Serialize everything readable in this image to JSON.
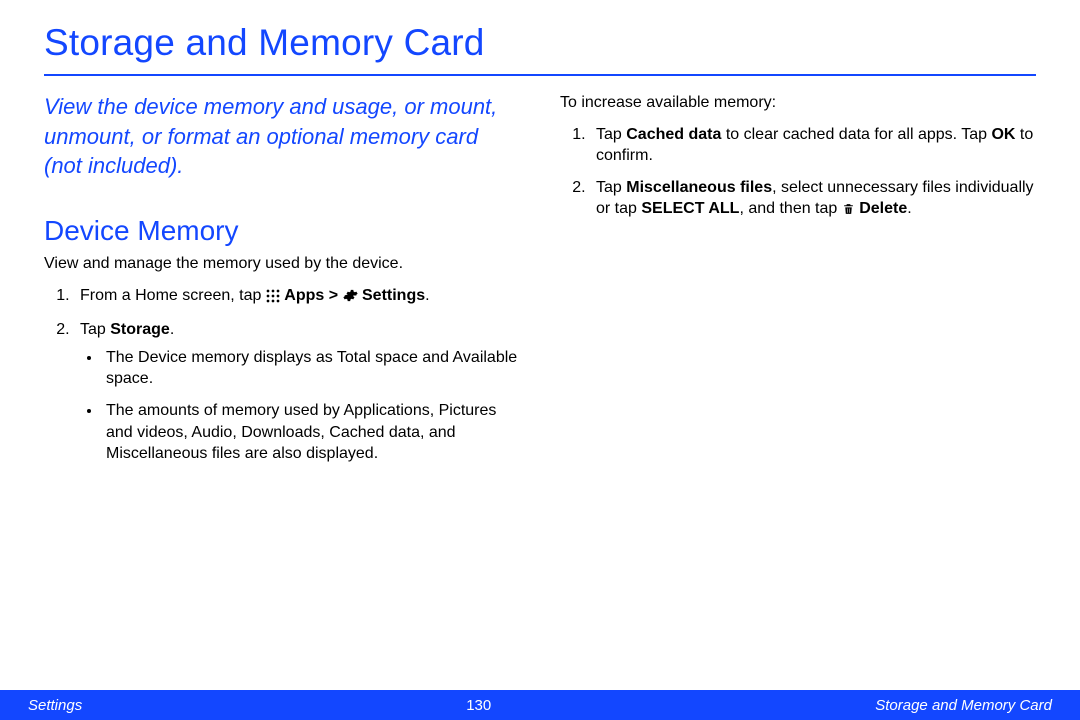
{
  "title": "Storage and Memory Card",
  "intro": "View the device memory and usage, or mount, unmount, or format an optional memory card (not included).",
  "section_heading": "Device Memory",
  "section_desc": "View and manage the memory used by the device.",
  "left": {
    "step1_prefix": "From a Home screen, tap ",
    "apps_label": "Apps",
    "gt": " > ",
    "settings_label": "Settings",
    "step1_suffix": ".",
    "step2_prefix": "Tap ",
    "storage_label": "Storage",
    "step2_suffix": ".",
    "bullet1": "The Device memory displays as Total space and Available space.",
    "bullet2": "The amounts of memory used by Applications, Pictures and videos, Audio, Downloads, Cached data, and Miscellaneous files are also displayed."
  },
  "right": {
    "intro": "To increase available memory:",
    "step1_a": "Tap ",
    "step1_b": "Cached data",
    "step1_c": " to clear cached data for all apps. Tap ",
    "step1_d": "OK",
    "step1_e": " to confirm.",
    "step2_a": "Tap ",
    "step2_b": "Miscellaneous files",
    "step2_c": ", select unnecessary files individually or tap ",
    "step2_d": "SELECT ALL",
    "step2_e": ", and then tap ",
    "delete_label": "Delete",
    "step2_f": "."
  },
  "footer": {
    "left": "Settings",
    "center": "130",
    "right": "Storage and Memory Card"
  }
}
